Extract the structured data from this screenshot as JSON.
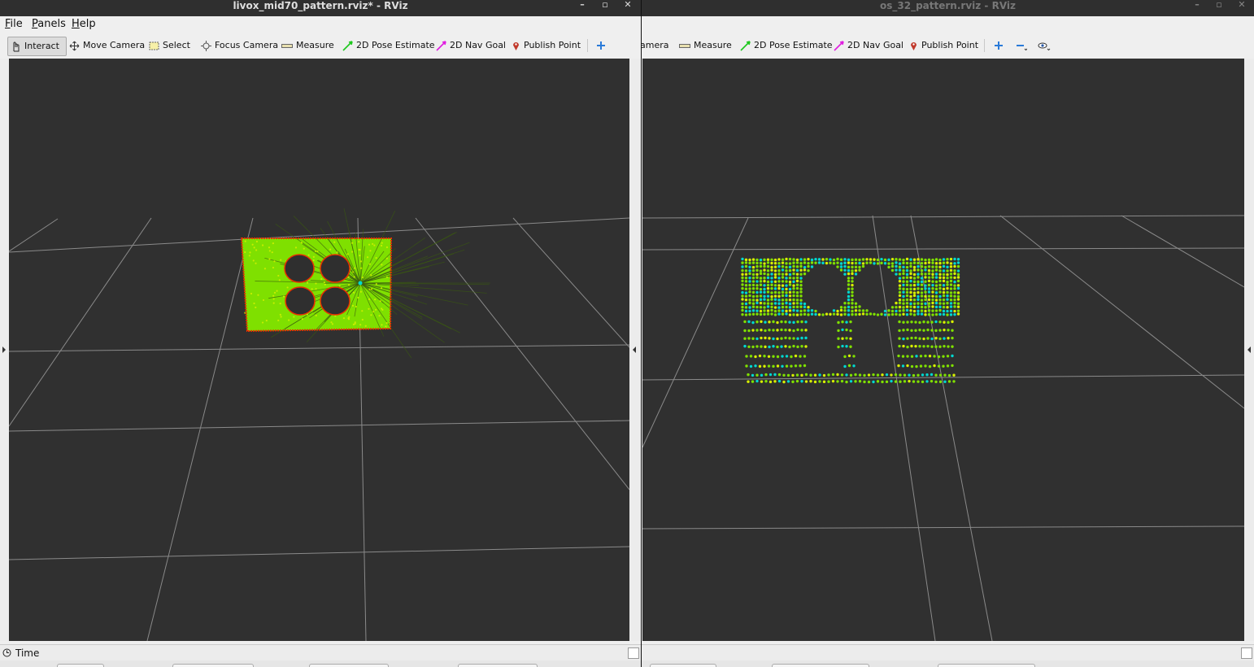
{
  "left_window": {
    "title": "livox_mid70_pattern.rviz* - RViz",
    "menu": {
      "file": {
        "accel": "F",
        "rest": "ile"
      },
      "panels": {
        "accel": "P",
        "rest": "anels"
      },
      "help": {
        "accel": "H",
        "rest": "elp"
      }
    },
    "toolbar": {
      "interact": "Interact",
      "move_camera": "Move Camera",
      "select": "Select",
      "focus_camera": "Focus Camera",
      "measure": "Measure",
      "pose_estimate": "2D Pose Estimate",
      "nav_goal": "2D Nav Goal",
      "publish_point": "Publish Point"
    },
    "time_panel": "Time"
  },
  "right_window": {
    "title": "os_32_pattern.rviz - RViz",
    "toolbar": {
      "overflow": "»",
      "camera_partial": "amera",
      "measure": "Measure",
      "pose_estimate": "2D Pose Estimate",
      "nav_goal": "2D Nav Goal",
      "publish_point": "Publish Point"
    }
  },
  "colors": {
    "viewport_bg": "#303030",
    "grid": "#8a8a8a",
    "points_green": "#7fe000",
    "points_yellow": "#d8f000",
    "points_cyan": "#00d8d0",
    "points_red": "#e83000",
    "pose_estimate": "#1ec81e",
    "nav_goal": "#e01ee0",
    "publish_point": "#c0392b",
    "add_tool": "#2a7ad8"
  }
}
